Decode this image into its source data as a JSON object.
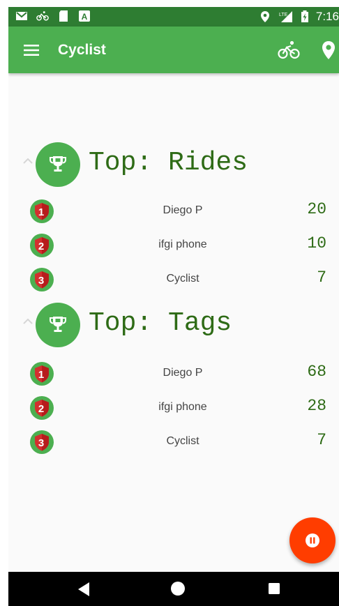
{
  "status_bar": {
    "left_icons": [
      "gmail-icon",
      "bike-icon",
      "sd-card-icon",
      "a-notification-icon"
    ],
    "right_icons": [
      "location-icon",
      "lte-signal-icon",
      "battery-charging-icon"
    ],
    "network_label": "LTE",
    "time": "7:16"
  },
  "app_bar": {
    "title": "Cyclist",
    "menu_icon": "menu-icon",
    "actions": [
      "bike-icon",
      "location-icon"
    ],
    "color": "#4caf50"
  },
  "sections": [
    {
      "title": "Top: Rides",
      "icon": "trophy-icon",
      "rows": [
        {
          "rank": "1",
          "name": "Diego P",
          "count": "20"
        },
        {
          "rank": "2",
          "name": "ifgi phone",
          "count": "10"
        },
        {
          "rank": "3",
          "name": "Cyclist",
          "count": "7"
        }
      ]
    },
    {
      "title": "Top: Tags",
      "icon": "trophy-icon",
      "rows": [
        {
          "rank": "1",
          "name": "Diego P",
          "count": "68"
        },
        {
          "rank": "2",
          "name": "ifgi phone",
          "count": "28"
        },
        {
          "rank": "3",
          "name": "Cyclist",
          "count": "7"
        }
      ]
    }
  ],
  "fab": {
    "icon": "pause-icon",
    "color": "#ff3d00"
  },
  "nav_bar": {
    "icons": [
      "back-icon",
      "home-icon",
      "recents-icon"
    ]
  }
}
